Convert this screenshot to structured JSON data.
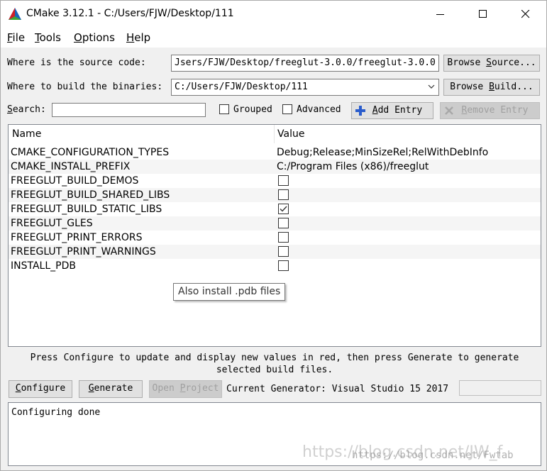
{
  "window": {
    "title": "CMake 3.12.1 - C:/Users/FJW/Desktop/111"
  },
  "menu": {
    "file": {
      "first": "F",
      "rest": "ile"
    },
    "tools": {
      "first": "T",
      "rest": "ools"
    },
    "options": {
      "first": "O",
      "rest": "ptions"
    },
    "help": {
      "first": "H",
      "rest": "elp"
    }
  },
  "source": {
    "label": "Where is the source code:",
    "value": "Jsers/FJW/Desktop/freeglut-3.0.0/freeglut-3.0.0",
    "browse_pre": "Browse ",
    "browse_ul": "S",
    "browse_post": "ource..."
  },
  "build": {
    "label": "Where to build the binaries:",
    "value": "C:/Users/FJW/Desktop/111",
    "browse_pre": "Browse ",
    "browse_ul": "B",
    "browse_post": "uild..."
  },
  "search": {
    "label_ul": "S",
    "label_rest": "earch:",
    "value": ""
  },
  "options": {
    "grouped": {
      "label": "Grouped",
      "checked": false
    },
    "advanced": {
      "label": "Advanced",
      "checked": false
    }
  },
  "add_entry": {
    "ul": "A",
    "rest": "dd Entry"
  },
  "remove_entry": {
    "ul": "R",
    "rest": "emove Entry"
  },
  "table": {
    "col_name": "Name",
    "col_value": "Value",
    "rows": [
      {
        "name": "CMAKE_CONFIGURATION_TYPES",
        "type": "text",
        "value": "Debug;Release;MinSizeRel;RelWithDebInfo"
      },
      {
        "name": "CMAKE_INSTALL_PREFIX",
        "type": "text",
        "value": "C:/Program Files (x86)/freeglut"
      },
      {
        "name": "FREEGLUT_BUILD_DEMOS",
        "type": "bool",
        "checked": false
      },
      {
        "name": "FREEGLUT_BUILD_SHARED_LIBS",
        "type": "bool",
        "checked": false
      },
      {
        "name": "FREEGLUT_BUILD_STATIC_LIBS",
        "type": "bool",
        "checked": true
      },
      {
        "name": "FREEGLUT_GLES",
        "type": "bool",
        "checked": false
      },
      {
        "name": "FREEGLUT_PRINT_ERRORS",
        "type": "bool",
        "checked": false
      },
      {
        "name": "FREEGLUT_PRINT_WARNINGS",
        "type": "bool",
        "checked": false
      },
      {
        "name": "INSTALL_PDB",
        "type": "bool",
        "checked": false
      }
    ]
  },
  "tooltip": "Also install .pdb files",
  "hint": {
    "line1": "Press Configure to update and display new values in red, then press Generate to generate",
    "line2": "selected build files."
  },
  "actions": {
    "configure": {
      "ul": "C",
      "rest": "onfigure"
    },
    "generate": {
      "ul": "G",
      "rest": "enerate"
    },
    "open_project": {
      "pre": "Open ",
      "ul": "P",
      "rest": "roject"
    },
    "generator_label": "Current Generator: Visual Studio 15 2017"
  },
  "log": {
    "text": "Configuring done"
  },
  "watermark": {
    "text1": "https://blog.csdn.net/JW_f",
    "text2": "https://blog.csdn.net/Fwtab"
  },
  "colors": {
    "accent_blue": "#2a5ccc",
    "title_bg": "#ffffff",
    "window_bg": "#f0f0f0"
  }
}
